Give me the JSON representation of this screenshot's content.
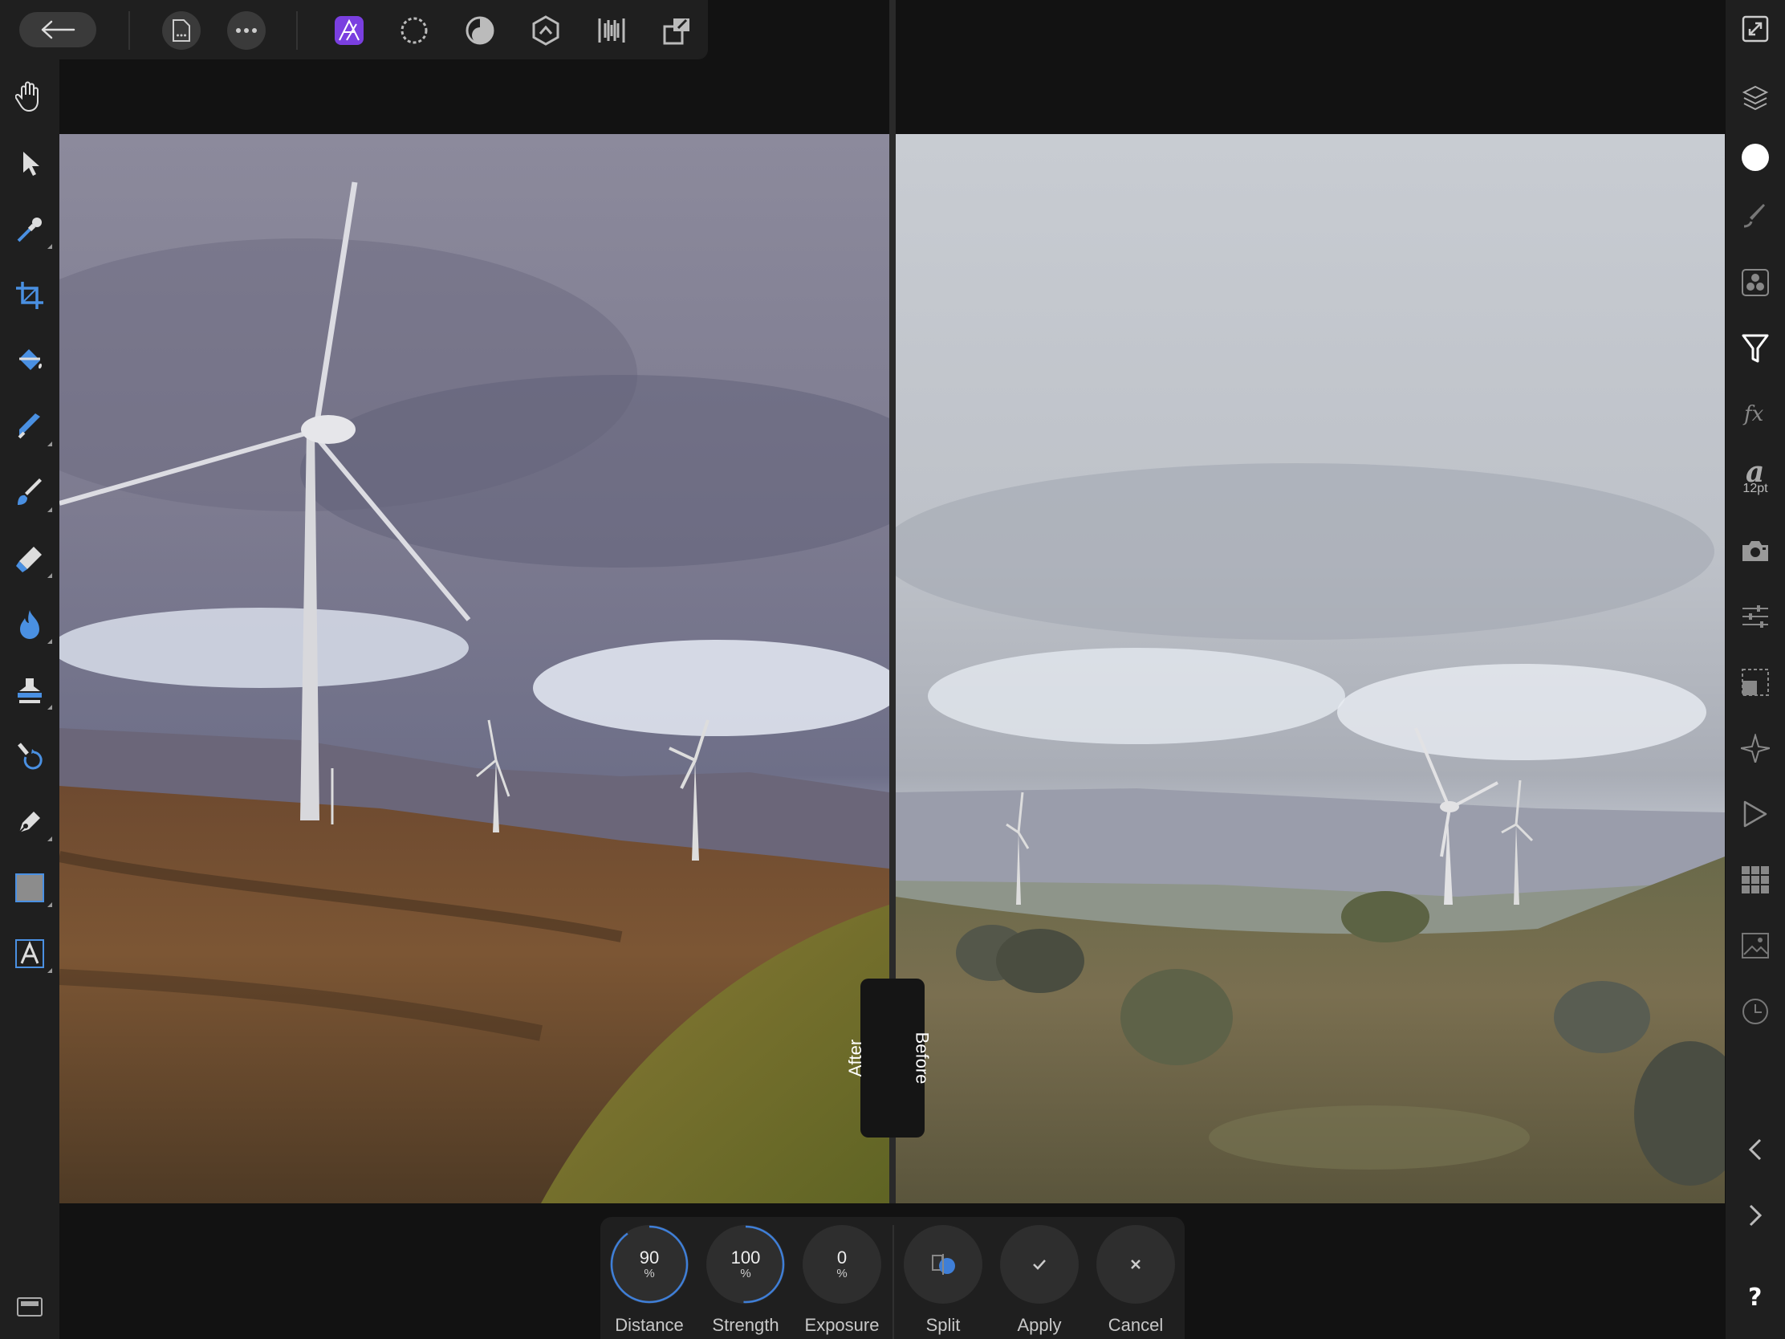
{
  "toolbar": {
    "back": "back-arrow-icon",
    "document_menu": "document-icon",
    "more": "more-icon",
    "personas": [
      "photo-persona",
      "liquify-persona",
      "develop-persona",
      "tone-mapping-persona",
      "export-persona"
    ]
  },
  "compare_labels": {
    "after": "After",
    "before": "Before"
  },
  "right_panel": {
    "font_size": "12pt"
  },
  "context_toolbar": {
    "controls": [
      {
        "value": "90",
        "unit": "%",
        "label": "Distance",
        "fraction": 0.9
      },
      {
        "value": "100",
        "unit": "%",
        "label": "Strength",
        "fraction": 1.0
      },
      {
        "value": "0",
        "unit": "%",
        "label": "Exposure",
        "fraction": 0
      }
    ],
    "actions": {
      "split": "Split",
      "apply": "Apply",
      "cancel": "Cancel"
    }
  },
  "colors": {
    "accent": "#3f7fd8",
    "persona_active": "#7a3fe0",
    "bar": "#1f1f1f",
    "background": "#121212"
  }
}
